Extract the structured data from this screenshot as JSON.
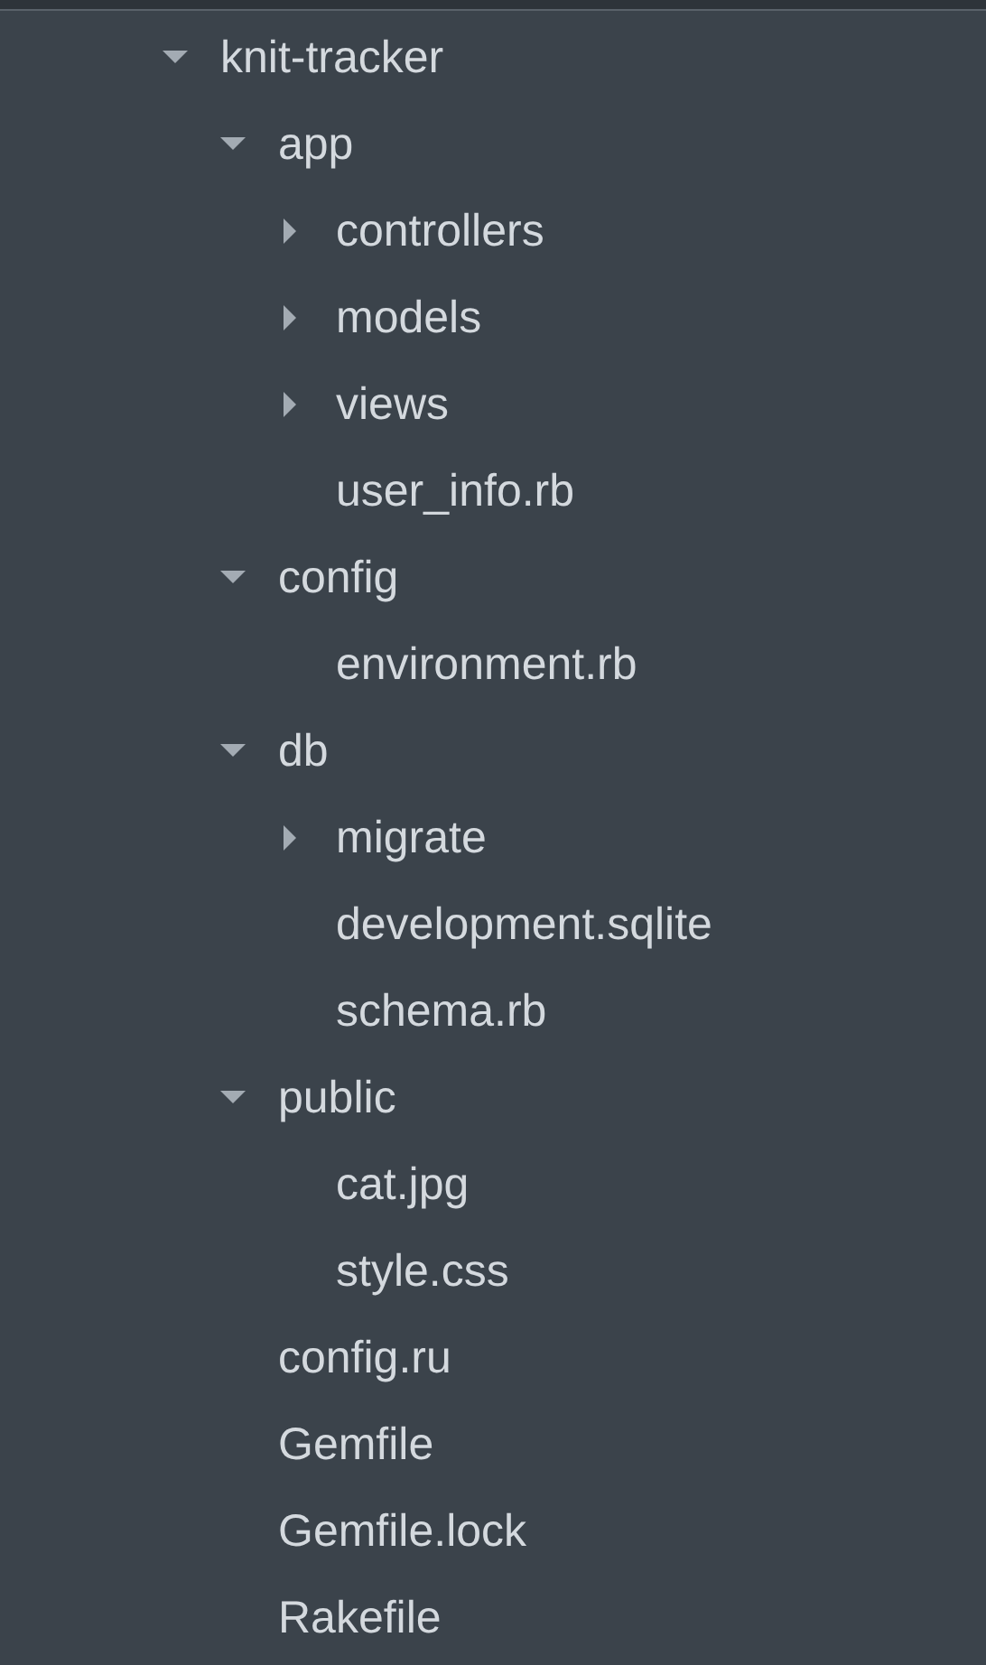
{
  "tree": [
    {
      "kind": "folder",
      "name": "knit-tracker",
      "expanded": true,
      "children": [
        {
          "kind": "folder",
          "name": "app",
          "expanded": true,
          "children": [
            {
              "kind": "folder",
              "name": "controllers",
              "expanded": false
            },
            {
              "kind": "folder",
              "name": "models",
              "expanded": false
            },
            {
              "kind": "folder",
              "name": "views",
              "expanded": false
            },
            {
              "kind": "file",
              "name": "user_info.rb"
            }
          ]
        },
        {
          "kind": "folder",
          "name": "config",
          "expanded": true,
          "children": [
            {
              "kind": "file",
              "name": "environment.rb"
            }
          ]
        },
        {
          "kind": "folder",
          "name": "db",
          "expanded": true,
          "children": [
            {
              "kind": "folder",
              "name": "migrate",
              "expanded": false
            },
            {
              "kind": "file",
              "name": "development.sqlite"
            },
            {
              "kind": "file",
              "name": "schema.rb"
            }
          ]
        },
        {
          "kind": "folder",
          "name": "public",
          "expanded": true,
          "children": [
            {
              "kind": "file",
              "name": "cat.jpg"
            },
            {
              "kind": "file",
              "name": "style.css"
            }
          ]
        },
        {
          "kind": "file",
          "name": "config.ru"
        },
        {
          "kind": "file",
          "name": "Gemfile"
        },
        {
          "kind": "file",
          "name": "Gemfile.lock"
        },
        {
          "kind": "file",
          "name": "Rakefile"
        }
      ]
    }
  ]
}
